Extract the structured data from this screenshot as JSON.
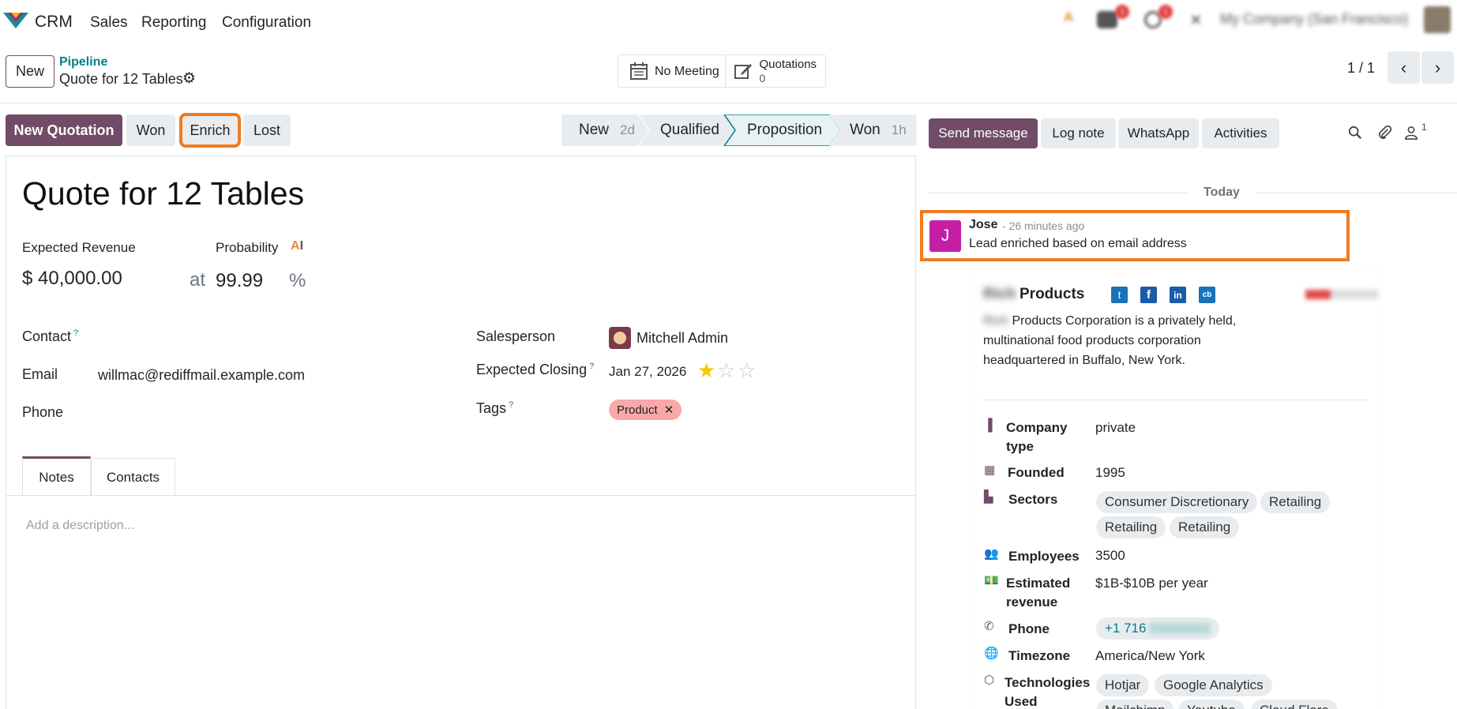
{
  "nav": {
    "brand": "CRM",
    "menu": [
      "Sales",
      "Reporting",
      "Configuration"
    ],
    "company": "My Company (San Francisco)",
    "badge_messages": "1",
    "badge_activities": "1"
  },
  "control": {
    "new_label": "New",
    "breadcrumb_parent": "Pipeline",
    "breadcrumb_current": "Quote for 12 Tables",
    "meeting_label": "No Meeting",
    "quotations_label": "Quotations",
    "quotations_count": "0",
    "pager": "1 / 1"
  },
  "actions": {
    "new_quotation": "New Quotation",
    "won": "Won",
    "enrich": "Enrich",
    "lost": "Lost"
  },
  "stages": [
    {
      "name": "New",
      "duration": "2d"
    },
    {
      "name": "Qualified",
      "duration": ""
    },
    {
      "name": "Proposition",
      "duration": ""
    },
    {
      "name": "Won",
      "duration": "1h"
    }
  ],
  "form": {
    "title": "Quote for 12 Tables",
    "expected_revenue_label": "Expected Revenue",
    "probability_label": "Probability",
    "expected_revenue": "$ 40,000.00",
    "at": "at",
    "probability": "99.99",
    "percent": "%",
    "contact_label": "Contact",
    "email_label": "Email",
    "email": "willmac@rediffmail.example.com",
    "phone_label": "Phone",
    "salesperson_label": "Salesperson",
    "salesperson": "Mitchell Admin",
    "expected_closing_label": "Expected Closing",
    "expected_closing": "Jan 27, 2026",
    "tags_label": "Tags",
    "tag": "Product",
    "help": "?",
    "tabs": [
      "Notes",
      "Contacts"
    ],
    "description_placeholder": "Add a description..."
  },
  "chatter": {
    "send_message": "Send message",
    "log_note": "Log note",
    "whatsapp": "WhatsApp",
    "activities": "Activities",
    "followers_count": "1",
    "date_separator": "Today",
    "message": {
      "avatar_letter": "J",
      "author": "Jose",
      "time": "- 26 minutes ago",
      "body": "Lead enriched based on email address"
    }
  },
  "company_card": {
    "name_prefix": "Rich",
    "name": "Products",
    "description_prefix": "Rich",
    "description": "Products Corporation is a privately held, multinational food products corporation headquartered in Buffalo, New York.",
    "social": [
      "twitter-icon",
      "facebook-icon",
      "linkedin-icon",
      "crunchbase-icon"
    ],
    "crunchbase_label": "cb",
    "company_type_label": "Company type",
    "company_type": "private",
    "founded_label": "Founded",
    "founded": "1995",
    "sectors_label": "Sectors",
    "sectors": [
      "Consumer Discretionary",
      "Retailing",
      "Retailing",
      "Retailing"
    ],
    "employees_label": "Employees",
    "employees": "3500",
    "revenue_label": "Estimated revenue",
    "revenue": "$1B-$10B per year",
    "phone_label": "Phone",
    "phone": "+1 716",
    "timezone_label": "Timezone",
    "timezone": "America/New York",
    "technologies_label": "Technologies Used",
    "technologies": [
      "Hotjar",
      "Google Analytics",
      "Mailchimp",
      "Youtube",
      "Cloud Flare"
    ]
  },
  "colors": {
    "brand": "#714b67",
    "teal": "#017e84",
    "highlight": "#f07b1f",
    "avatar": "#c51ea6",
    "tag_bg": "#f8a8a8"
  }
}
